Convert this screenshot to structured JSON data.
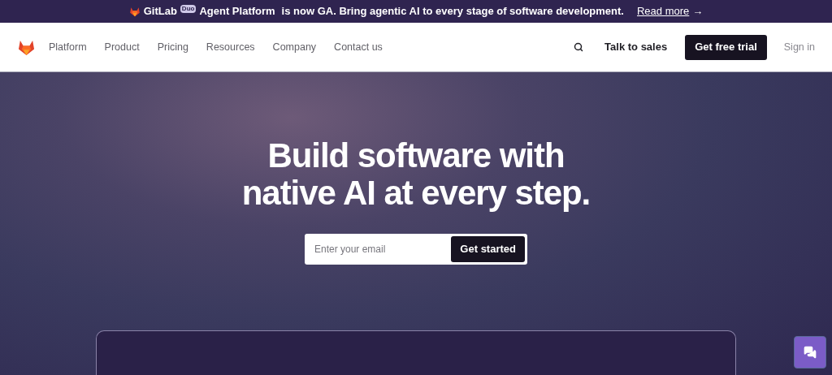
{
  "banner": {
    "brand": "GitLab",
    "badge": "Duo",
    "product": "Agent Platform",
    "message": "is now GA. Bring agentic AI to every stage of software development.",
    "link": "Read more",
    "arrow": "→"
  },
  "nav": {
    "items": [
      "Platform",
      "Product",
      "Pricing",
      "Resources",
      "Company",
      "Contact us"
    ],
    "talk": "Talk to sales",
    "trial": "Get free trial",
    "signin": "Sign in"
  },
  "hero": {
    "title_lines": [
      "Build software with",
      "native AI at every step."
    ],
    "email_placeholder": "Enter your email",
    "cta": "Get started"
  }
}
